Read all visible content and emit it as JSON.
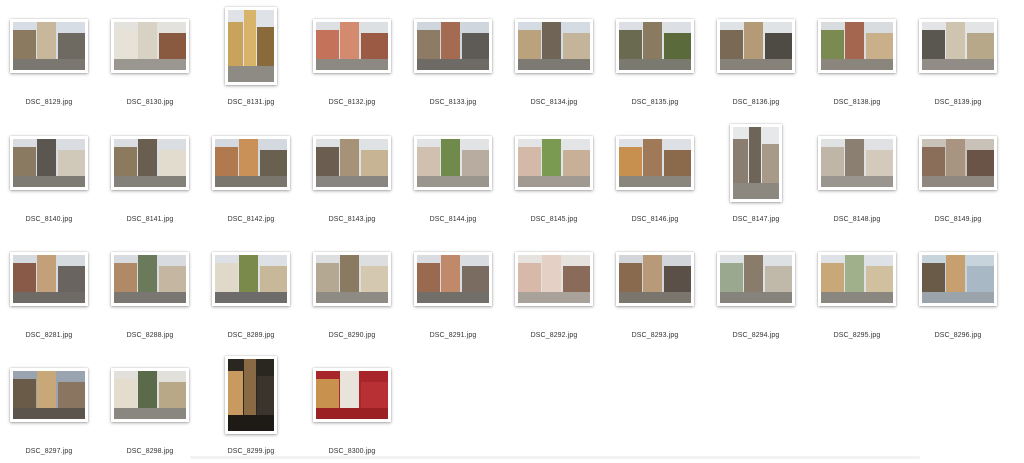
{
  "files": [
    {
      "name": "DSC_8129.jpg",
      "orient": "land",
      "sky": "#d7dde4",
      "walls": [
        "#8b7a60",
        "#c8b79a",
        "#6e6a62"
      ],
      "road": "#7a7670"
    },
    {
      "name": "DSC_8130.jpg",
      "orient": "land",
      "sky": "#e4e2dc",
      "walls": [
        "#e7e2d8",
        "#d8d2c4",
        "#8a5a40"
      ],
      "road": "#9a9690"
    },
    {
      "name": "DSC_8131.jpg",
      "orient": "port",
      "sky": "#dfe3e7",
      "walls": [
        "#c9a35b",
        "#d7b46a",
        "#8a6a3a"
      ],
      "road": "#8e8a84"
    },
    {
      "name": "DSC_8132.jpg",
      "orient": "land",
      "sky": "#dde0e3",
      "walls": [
        "#c4735a",
        "#d48a6e",
        "#9a5a44"
      ],
      "road": "#8c8882"
    },
    {
      "name": "DSC_8133.jpg",
      "orient": "land",
      "sky": "#cfd6dd",
      "walls": [
        "#8d7b66",
        "#a56a52",
        "#5e5a56"
      ],
      "road": "#6e6a66"
    },
    {
      "name": "DSC_8134.jpg",
      "orient": "land",
      "sky": "#d5dbe2",
      "walls": [
        "#b9a27c",
        "#6f6456",
        "#c4b49a"
      ],
      "road": "#7d7a74"
    },
    {
      "name": "DSC_8135.jpg",
      "orient": "land",
      "sky": "#dce0e4",
      "walls": [
        "#6a6a50",
        "#8a7a60",
        "#5b6a3a"
      ],
      "road": "#7a7a70"
    },
    {
      "name": "DSC_8136.jpg",
      "orient": "land",
      "sky": "#e0e3e6",
      "walls": [
        "#7a6a55",
        "#b59a78",
        "#4e4a44"
      ],
      "road": "#86827a"
    },
    {
      "name": "DSC_8138.jpg",
      "orient": "land",
      "sky": "#d8dcdf",
      "walls": [
        "#7a8a50",
        "#a4664e",
        "#c9b08a"
      ],
      "road": "#8a867e"
    },
    {
      "name": "DSC_8139.jpg",
      "orient": "land",
      "sky": "#e2e4e6",
      "walls": [
        "#5a5650",
        "#cfc4b0",
        "#b8a88a"
      ],
      "road": "#918d86"
    },
    {
      "name": "DSC_8140.jpg",
      "orient": "land",
      "sky": "#d9dde1",
      "walls": [
        "#8a7a62",
        "#5c5650",
        "#d0c8b8"
      ],
      "road": "#7e7a74"
    },
    {
      "name": "DSC_8141.jpg",
      "orient": "land",
      "sky": "#dadee2",
      "walls": [
        "#8c7a5e",
        "#6a5e50",
        "#e2dccf"
      ],
      "road": "#84807a"
    },
    {
      "name": "DSC_8142.jpg",
      "orient": "land",
      "sky": "#d3d9df",
      "walls": [
        "#b07a4e",
        "#c99058",
        "#6a6050"
      ],
      "road": "#7a766e"
    },
    {
      "name": "DSC_8143.jpg",
      "orient": "land",
      "sky": "#dfe2e5",
      "walls": [
        "#6b5e50",
        "#a69276",
        "#c6b494"
      ],
      "road": "#888480"
    },
    {
      "name": "DSC_8144.jpg",
      "orient": "land",
      "sky": "#e1e3e5",
      "walls": [
        "#cfc0b0",
        "#6f8a4a",
        "#b8aca0"
      ],
      "road": "#9a968e"
    },
    {
      "name": "DSC_8145.jpg",
      "orient": "land",
      "sky": "#e3e4e5",
      "walls": [
        "#d4b8a8",
        "#7a9a52",
        "#c8b098"
      ],
      "road": "#a09a92"
    },
    {
      "name": "DSC_8146.jpg",
      "orient": "land",
      "sky": "#dde1e5",
      "walls": [
        "#c8904e",
        "#a07a58",
        "#8a6a4a"
      ],
      "road": "#8a867e"
    },
    {
      "name": "DSC_8147.jpg",
      "orient": "port",
      "sky": "#e6e8ea",
      "walls": [
        "#8a7e70",
        "#6e6458",
        "#a89a88"
      ],
      "road": "#8c887f"
    },
    {
      "name": "DSC_8148.jpg",
      "orient": "land",
      "sky": "#dfe1e3",
      "walls": [
        "#bfb6a8",
        "#8a7f70",
        "#d4cabc"
      ],
      "road": "#9a968f"
    },
    {
      "name": "DSC_8149.jpg",
      "orient": "land",
      "sky": "#c9c2b8",
      "walls": [
        "#8a6e5a",
        "#a89480",
        "#6a5448"
      ],
      "road": "#8e8880"
    },
    {
      "name": "DSC_8281.jpg",
      "orient": "land",
      "sky": "#d6dbe0",
      "walls": [
        "#8a5a48",
        "#c4a07a",
        "#6a6460"
      ],
      "road": "#6e6a66"
    },
    {
      "name": "DSC_8288.jpg",
      "orient": "land",
      "sky": "#d8dce0",
      "walls": [
        "#b08a66",
        "#6a7a5a",
        "#c4b6a0"
      ],
      "road": "#7a7672"
    },
    {
      "name": "DSC_8289.jpg",
      "orient": "land",
      "sky": "#dde1e5",
      "walls": [
        "#e0d8c8",
        "#7a8a4a",
        "#c8b89a"
      ],
      "road": "#6e6c6a"
    },
    {
      "name": "DSC_8290.jpg",
      "orient": "land",
      "sky": "#dcdedf",
      "walls": [
        "#b4a892",
        "#8a7a62",
        "#d4c8b0"
      ],
      "road": "#8e8a84"
    },
    {
      "name": "DSC_8291.jpg",
      "orient": "land",
      "sky": "#d9dde1",
      "walls": [
        "#9a6a50",
        "#c08a6a",
        "#7a6c60"
      ],
      "road": "#726e6a"
    },
    {
      "name": "DSC_8292.jpg",
      "orient": "land",
      "sky": "#e6e2de",
      "walls": [
        "#d8b8a8",
        "#e4d0c4",
        "#8a6a58"
      ],
      "road": "#a8a29a"
    },
    {
      "name": "DSC_8293.jpg",
      "orient": "land",
      "sky": "#d2d6da",
      "walls": [
        "#8a6a4e",
        "#b89a78",
        "#5a5048"
      ],
      "road": "#7a766e"
    },
    {
      "name": "DSC_8294.jpg",
      "orient": "land",
      "sky": "#dde1e4",
      "walls": [
        "#9aa890",
        "#8a7c6a",
        "#c0b8a8"
      ],
      "road": "#86827c"
    },
    {
      "name": "DSC_8295.jpg",
      "orient": "land",
      "sky": "#dee2e6",
      "walls": [
        "#c8a878",
        "#a0b08a",
        "#d0c0a0"
      ],
      "road": "#8a8680"
    },
    {
      "name": "DSC_8296.jpg",
      "orient": "land",
      "sky": "#c8d4dc",
      "walls": [
        "#6a5a48",
        "#c8a070",
        "#a8b8c4"
      ],
      "road": "#9aa4aa"
    },
    {
      "name": "DSC_8297.jpg",
      "orient": "land",
      "sky": "#9aa4b0",
      "walls": [
        "#6a5a48",
        "#c8a878",
        "#8a7660"
      ],
      "road": "#5a544c"
    },
    {
      "name": "DSC_8298.jpg",
      "orient": "land",
      "sky": "#e2e0da",
      "walls": [
        "#e4dccc",
        "#5a6a4a",
        "#b8a888"
      ],
      "road": "#8a8680"
    },
    {
      "name": "DSC_8299.jpg",
      "orient": "port",
      "sky": "#2a2620",
      "walls": [
        "#c89a60",
        "#8a6a44",
        "#3a342c"
      ],
      "road": "#1e1a16"
    },
    {
      "name": "DSC_8300.jpg",
      "orient": "land",
      "sky": "#a8262a",
      "walls": [
        "#c8924e",
        "#e8e4dc",
        "#b83034"
      ],
      "road": "#9a2024"
    }
  ]
}
